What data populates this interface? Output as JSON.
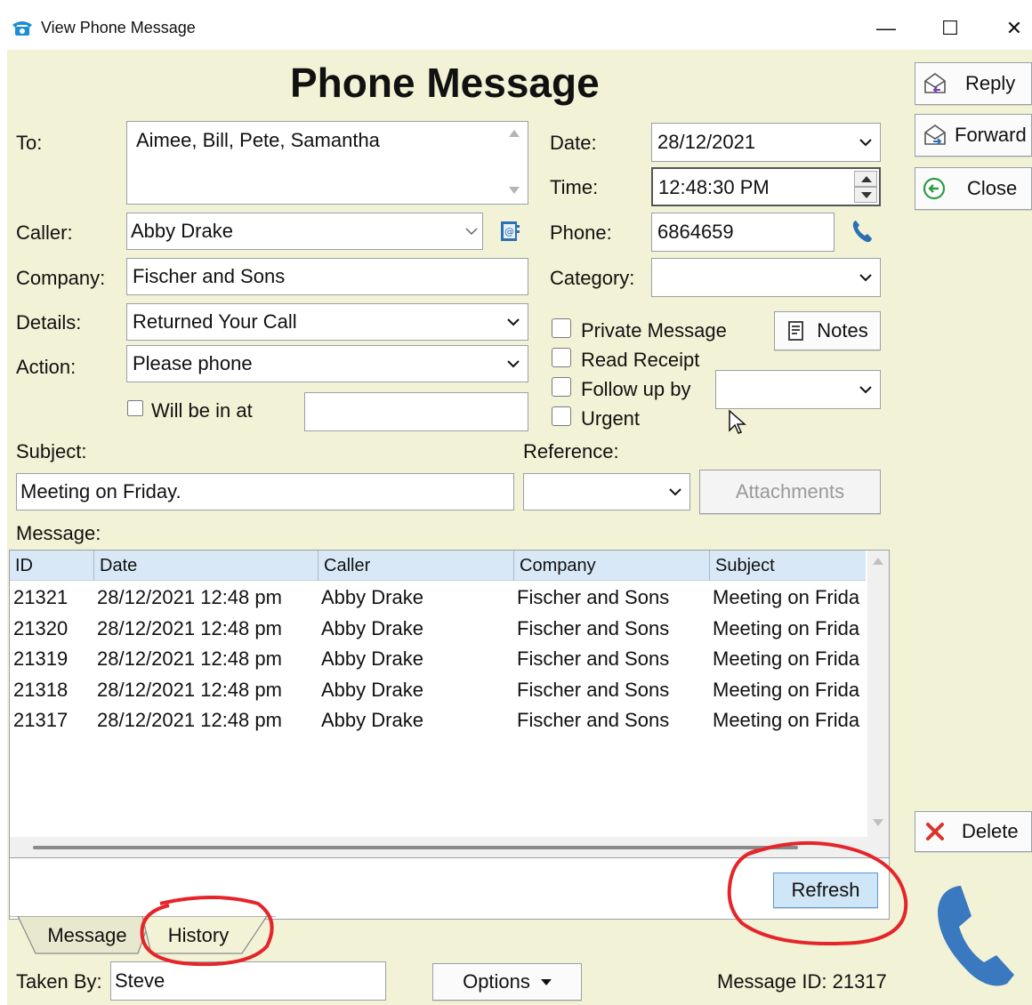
{
  "window": {
    "title": "View Phone Message",
    "minimize": "—",
    "maximize": "☐",
    "close": "✕"
  },
  "form": {
    "heading": "Phone Message",
    "to_label": "To:",
    "to_value": "Aimee,  Bill,  Pete,  Samantha",
    "caller_label": "Caller:",
    "caller_value": "Abby Drake",
    "company_label": "Company:",
    "company_value": "Fischer and Sons",
    "details_label": "Details:",
    "details_value": "Returned Your Call",
    "action_label": "Action:",
    "action_value": "Please phone",
    "will_be_in_label": "Will be in at",
    "will_be_in_value": "",
    "date_label": "Date:",
    "date_value": "28/12/2021",
    "time_label": "Time:",
    "time_value": "12:48:30 PM",
    "phone_label": "Phone:",
    "phone_value": "6864659",
    "category_label": "Category:",
    "category_value": "",
    "private_label": "Private Message",
    "read_receipt_label": "Read Receipt",
    "follow_up_label": "Follow up by",
    "follow_up_value": "",
    "urgent_label": "Urgent",
    "notes_label": "Notes",
    "subject_label": "Subject:",
    "subject_value": "Meeting on Friday.",
    "reference_label": "Reference:",
    "reference_value": "",
    "attachments_label": "Attachments",
    "message_label": "Message:"
  },
  "side_buttons": {
    "reply": "Reply",
    "forward": "Forward",
    "close": "Close",
    "delete": "Delete"
  },
  "history": {
    "columns": [
      "ID",
      "Date",
      "Caller",
      "Company",
      "Subject"
    ],
    "rows": [
      {
        "id": "21321",
        "date": "28/12/2021 12:48 pm",
        "caller": "Abby Drake",
        "company": "Fischer and Sons",
        "subject": "Meeting on Frida"
      },
      {
        "id": "21320",
        "date": "28/12/2021 12:48 pm",
        "caller": "Abby Drake",
        "company": "Fischer and Sons",
        "subject": "Meeting on Frida"
      },
      {
        "id": "21319",
        "date": "28/12/2021 12:48 pm",
        "caller": "Abby Drake",
        "company": "Fischer and Sons",
        "subject": "Meeting on Frida"
      },
      {
        "id": "21318",
        "date": "28/12/2021 12:48 pm",
        "caller": "Abby Drake",
        "company": "Fischer and Sons",
        "subject": "Meeting on Frida"
      },
      {
        "id": "21317",
        "date": "28/12/2021 12:48 pm",
        "caller": "Abby Drake",
        "company": "Fischer and Sons",
        "subject": "Meeting on Frida"
      }
    ],
    "refresh_label": "Refresh"
  },
  "tabs": [
    {
      "label": "Message"
    },
    {
      "label": "History"
    }
  ],
  "footer": {
    "taken_by_label": "Taken By:",
    "taken_by_value": "Steve",
    "options_label": "Options",
    "message_id_text": "Message ID: 21317"
  },
  "colors": {
    "background": "#f2f2d6",
    "list_header": "#d9e8f7",
    "refresh_button": "#cfe6f7",
    "annotation_red": "#e5252a",
    "phone_icon_blue": "#3a78c0",
    "delete_red": "#d9342b"
  },
  "icons": [
    "telephone-app-icon",
    "address-book-icon",
    "phone-dial-icon",
    "notes-icon",
    "reply-icon",
    "forward-icon",
    "back-arrow-icon",
    "delete-x-icon",
    "large-phone-icon",
    "mouse-cursor-icon"
  ]
}
